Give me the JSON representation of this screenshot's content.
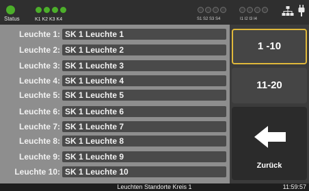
{
  "status_bar": {
    "status_label": "Status",
    "k_label": "K1 K2 K3 K4",
    "s_label": "S1 S2 S3 S4",
    "i_label": "I1 I2 I3 I4",
    "status_color": "#4caf2a",
    "network_icon": "network-icon",
    "plug_icon": "plug-icon"
  },
  "list": {
    "rows": [
      {
        "label": "Leuchte 1:",
        "value": "SK 1 Leuchte 1"
      },
      {
        "label": "Leuchte 2:",
        "value": "SK 1 Leuchte 2"
      },
      {
        "label": "Leuchte 3:",
        "value": "SK 1 Leuchte 3"
      },
      {
        "label": "Leuchte 4:",
        "value": "SK 1 Leuchte 4"
      },
      {
        "label": "Leuchte 5:",
        "value": "SK 1 Leuchte 5"
      },
      {
        "label": "Leuchte 6:",
        "value": "SK 1 Leuchte 6"
      },
      {
        "label": "Leuchte 7:",
        "value": "SK 1 Leuchte 7"
      },
      {
        "label": "Leuchte 8:",
        "value": "SK 1 Leuchte 8"
      },
      {
        "label": "Leuchte 9:",
        "value": "SK 1 Leuchte 9"
      },
      {
        "label": "Leuchte 10:",
        "value": "SK 1 Leuchte 10"
      }
    ]
  },
  "panel": {
    "range1_label": "1 -10",
    "range2_label": "11-20",
    "back_label": "Zurück",
    "back_icon": "arrow-left-icon",
    "selected_color": "#e0b93b"
  },
  "bottom_bar": {
    "title": "Leuchten Standorte Kreis 1",
    "time": "11:59:57"
  }
}
